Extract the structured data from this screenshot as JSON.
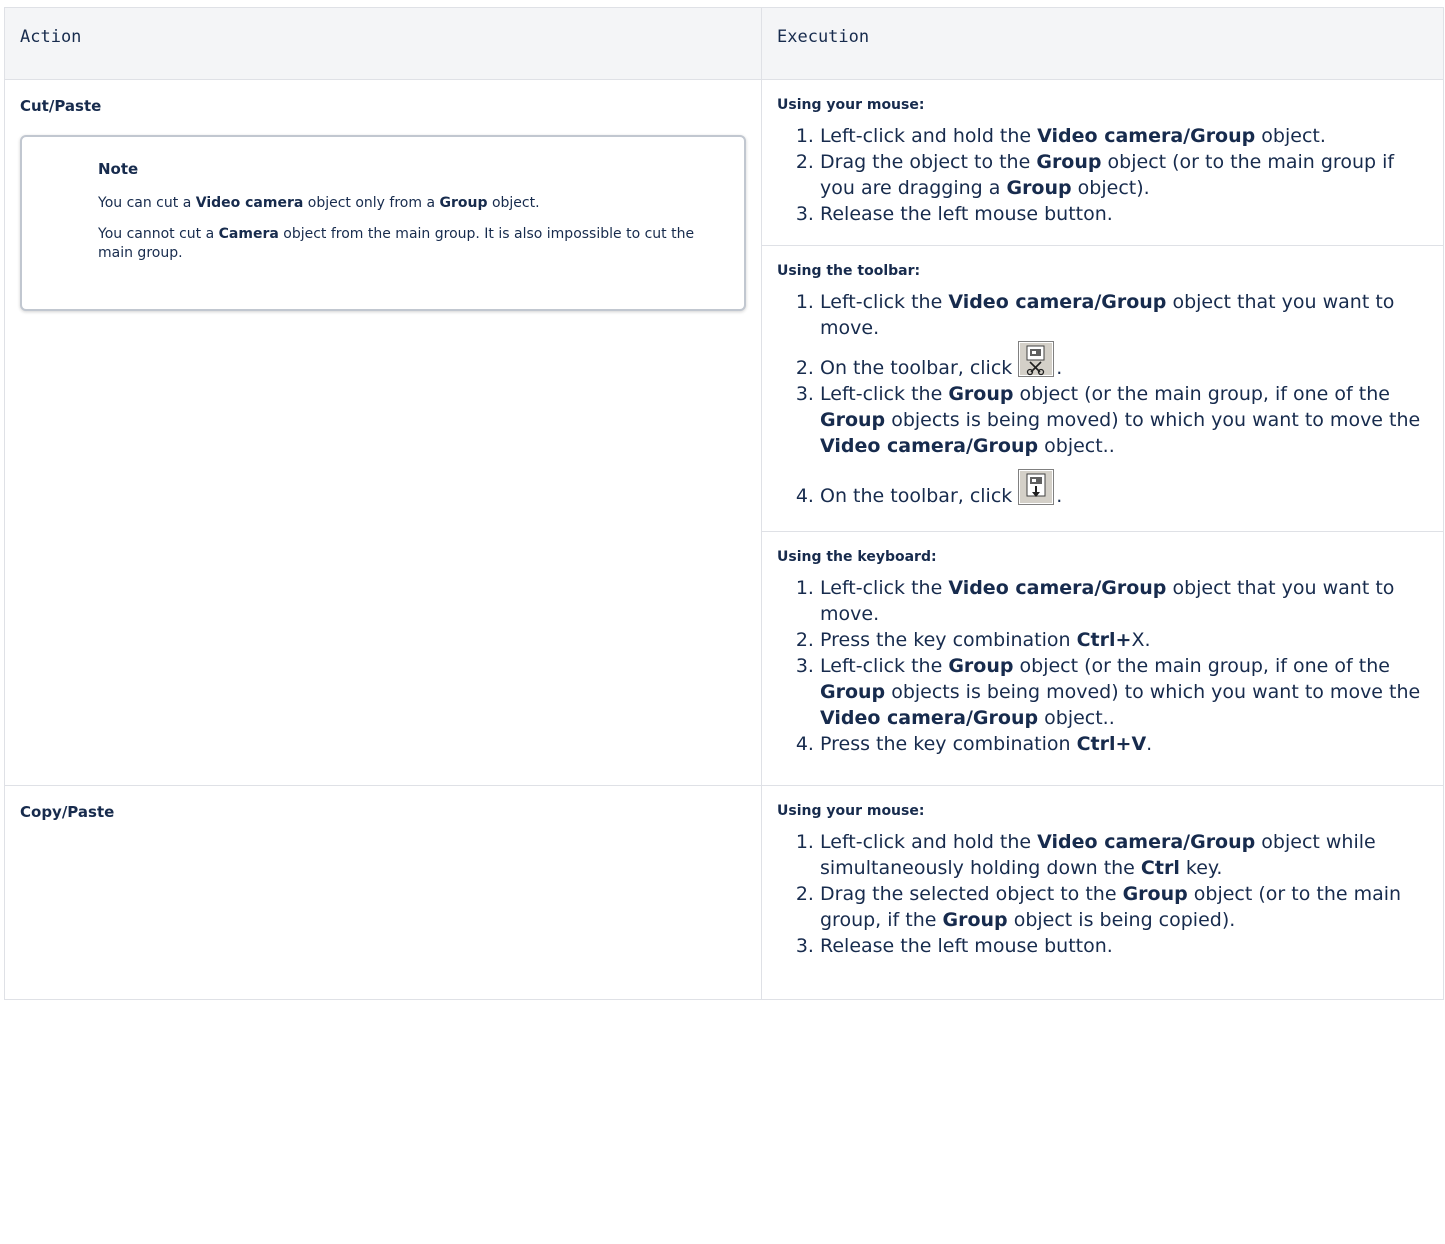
{
  "header": {
    "action": "Action",
    "execution": "Execution"
  },
  "rows": [
    {
      "action": "Cut/Paste",
      "note": {
        "title": "Note",
        "p1": {
          "t1": "You can cut a ",
          "b1": "Video camera",
          "t2": " object only from a ",
          "b2": "Group",
          "t3": " object."
        },
        "p2": {
          "t1": "You cannot cut a ",
          "b1": "Camera",
          "t2": " object from the main group. It is also impossible to cut the main group."
        }
      },
      "mouse": {
        "heading": "Using your mouse:",
        "s1": {
          "t1": "Left-click and hold the ",
          "b1": "Video camera/Group",
          "t2": " object."
        },
        "s2": {
          "t1": "Drag the object to the ",
          "b1": "Group",
          "t2": " object (or to the main group if you are dragging a ",
          "b2": "Group",
          "t3": " object)."
        },
        "s3": {
          "t1": "Release the left mouse button."
        }
      },
      "toolbar": {
        "heading": "Using the toolbar:",
        "s1": {
          "t1": "Left-click the ",
          "b1": "Video camera/Group",
          "t2": " object that you want to move."
        },
        "s2": {
          "t1": "On the toolbar, click",
          "t2": "."
        },
        "s3": {
          "t1": "Left-click the ",
          "b1": "Group",
          "t2": " object (or the main group, if one of the ",
          "b2": "Group",
          "t3": " objects is being moved) to which you want to move the ",
          "b3": "Video camera/Group",
          "t4": " object.."
        },
        "s4": {
          "t1": "On the toolbar, click",
          "t2": "."
        }
      },
      "keyboard": {
        "heading": "Using the keyboard:",
        "s1": {
          "t1": "Left-click the ",
          "b1": "Video camera/Group",
          "t2": " object that you want to move."
        },
        "s2": {
          "t1": "Press the key combination ",
          "b1": "Ctrl+",
          "t2": "X."
        },
        "s3": {
          "t1": "Left-click the ",
          "b1": "Group",
          "t2": " object (or the main group, if one of the ",
          "b2": "Group",
          "t3": " objects is being moved) to which you want to move the ",
          "b3": "Video camera/Group",
          "t4": " object.."
        },
        "s4": {
          "t1": "Press the key combination ",
          "b1": "Ctrl+V",
          "t2": "."
        }
      }
    },
    {
      "action": "Copy/Paste",
      "mouse": {
        "heading": "Using your mouse:",
        "s1": {
          "t1": "Left-click and hold the ",
          "b1": "Video camera/Group",
          "t2": " object while simultaneously holding down the ",
          "b2": "Ctrl",
          "t3": " key."
        },
        "s2": {
          "t1": "Drag the selected object to the ",
          "b1": "Group",
          "t2": " object (or to the main group, if the ",
          "b2": "Group",
          "t3": " object is being copied)."
        },
        "s3": {
          "t1": "Release the left mouse button."
        }
      }
    }
  ],
  "icons": {
    "cut": "cut-camera-icon",
    "paste": "paste-camera-icon"
  }
}
